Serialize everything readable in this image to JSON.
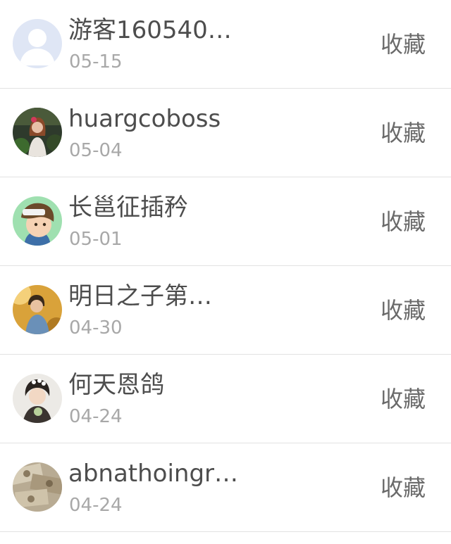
{
  "items": [
    {
      "name": "游客160540…",
      "date": "05-15",
      "action": "收藏",
      "avatar_icon": "default-user-avatar-icon"
    },
    {
      "name": "huargcoboss",
      "date": "05-04",
      "action": "收藏",
      "avatar_icon": "user-photo-avatar-icon"
    },
    {
      "name": "长邕征插矜",
      "date": "05-01",
      "action": "收藏",
      "avatar_icon": "cartoon-boy-avatar-icon"
    },
    {
      "name": "明日之子第…",
      "date": "04-30",
      "action": "收藏",
      "avatar_icon": "user-photo-avatar-icon"
    },
    {
      "name": "何天恩鸽",
      "date": "04-24",
      "action": "收藏",
      "avatar_icon": "user-photo-avatar-icon"
    },
    {
      "name": "abnathoingr…",
      "date": "04-24",
      "action": "收藏",
      "avatar_icon": "money-photo-avatar-icon"
    }
  ],
  "colors": {
    "name_text": "#4d4d4d",
    "date_text": "#a8a8a8",
    "action_text": "#6a6a6a",
    "divider": "#e2e2e2",
    "default_avatar_bg": "#dfe6f5"
  }
}
